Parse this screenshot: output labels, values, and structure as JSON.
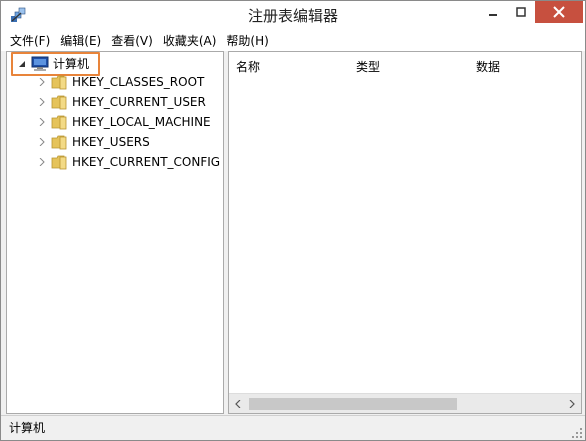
{
  "window": {
    "title": "注册表编辑器",
    "app_icon": "regedit-icon",
    "close_color": "#c7503f"
  },
  "menu": {
    "items": [
      {
        "label": "文件(F)"
      },
      {
        "label": "编辑(E)"
      },
      {
        "label": "查看(V)"
      },
      {
        "label": "收藏夹(A)"
      },
      {
        "label": "帮助(H)"
      }
    ]
  },
  "tree": {
    "root": {
      "label": "计算机",
      "icon": "computer-icon",
      "expanded": true,
      "highlight_color": "#e8843a"
    },
    "children": [
      {
        "label": "HKEY_CLASSES_ROOT",
        "icon": "folder-icon"
      },
      {
        "label": "HKEY_CURRENT_USER",
        "icon": "folder-icon"
      },
      {
        "label": "HKEY_LOCAL_MACHINE",
        "icon": "folder-icon"
      },
      {
        "label": "HKEY_USERS",
        "icon": "folder-icon"
      },
      {
        "label": "HKEY_CURRENT_CONFIG",
        "icon": "folder-icon"
      }
    ]
  },
  "list": {
    "columns": [
      {
        "label": "名称"
      },
      {
        "label": "类型"
      },
      {
        "label": "数据"
      }
    ]
  },
  "status": {
    "text": "计算机"
  }
}
